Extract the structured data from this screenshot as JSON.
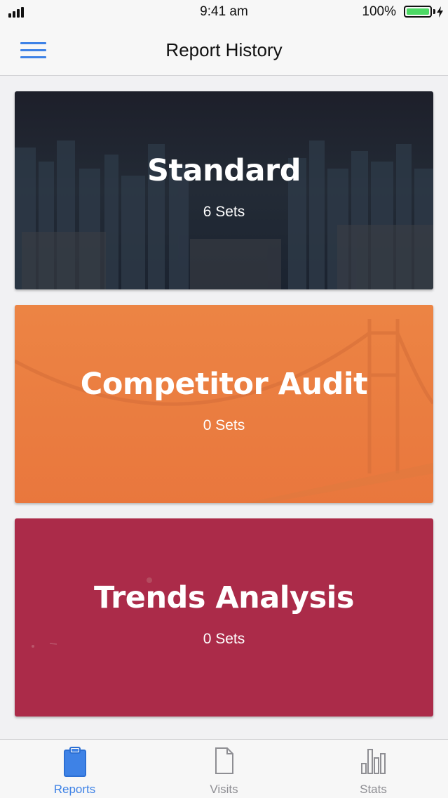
{
  "status_bar": {
    "time": "9:41 am",
    "battery_percent": "100%",
    "battery_level": 1.0
  },
  "nav": {
    "title": "Report History",
    "menu_icon": "hamburger-menu-icon"
  },
  "cards": [
    {
      "title": "Standard",
      "sets": "6 Sets",
      "color": "#1f2733",
      "background": "city-skyline-photo"
    },
    {
      "title": "Competitor Audit",
      "sets": "0 Sets",
      "color": "#ee8543",
      "background": "golden-gate-bridge-photo"
    },
    {
      "title": "Trends Analysis",
      "sets": "0 Sets",
      "color": "#ab2b49",
      "background": "aerial-photo"
    }
  ],
  "tabs": [
    {
      "label": "Reports",
      "icon": "clipboard-icon",
      "active": true
    },
    {
      "label": "Visits",
      "icon": "document-icon",
      "active": false
    },
    {
      "label": "Stats",
      "icon": "bar-chart-icon",
      "active": false
    }
  ],
  "colors": {
    "accent": "#3e82e6",
    "inactive": "#8e8e93",
    "battery_fill": "#4cd964"
  }
}
